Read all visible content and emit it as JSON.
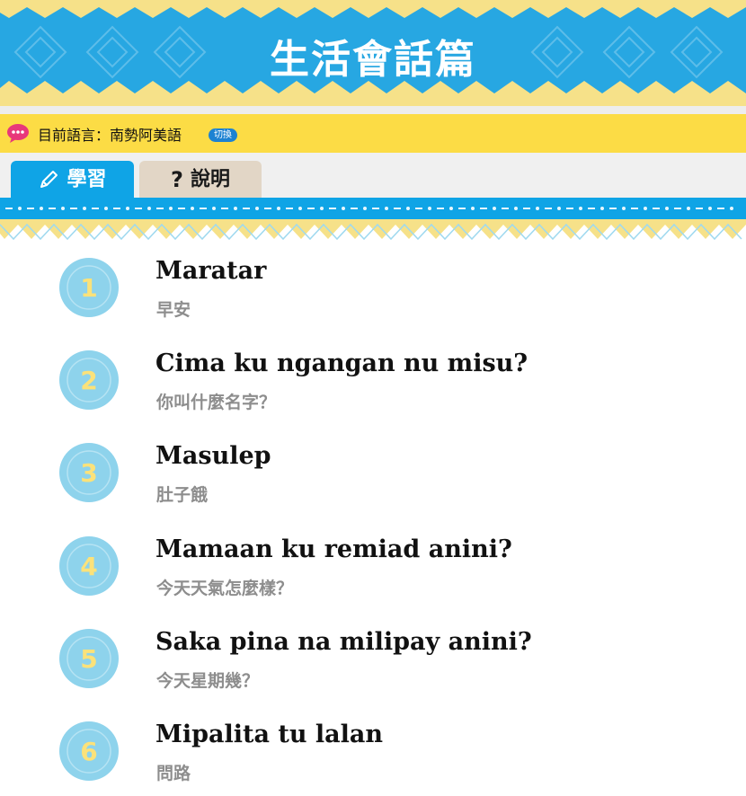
{
  "header": {
    "title": "生活會話篇"
  },
  "language_bar": {
    "icon": "speech-bubble-icon",
    "label": "目前語言：南勢阿美語",
    "switch_label": "切換"
  },
  "tabs": [
    {
      "icon": "pencil-icon",
      "label": "學習",
      "active": true
    },
    {
      "icon": "question-mark-icon",
      "label": "說明",
      "active": false
    }
  ],
  "lessons": [
    {
      "number": "1",
      "phrase": "Maratar",
      "translation": "早安"
    },
    {
      "number": "2",
      "phrase": "Cima ku ngangan nu misu?",
      "translation": "你叫什麼名字？"
    },
    {
      "number": "3",
      "phrase": "Masulep",
      "translation": "肚子餓"
    },
    {
      "number": "4",
      "phrase": "Mamaan ku remiad anini?",
      "translation": "今天天氣怎麼樣？"
    },
    {
      "number": "5",
      "phrase": "Saka pina na milipay anini?",
      "translation": "今天星期幾？"
    },
    {
      "number": "6",
      "phrase": "Mipalita tu lalan",
      "translation": "問路"
    }
  ],
  "colors": {
    "banner_blue": "#27a7e2",
    "yellow": "#fcdc45",
    "tab_active": "#0fa4e6",
    "tab_inactive": "#e2d6c6",
    "badge_fill": "#8ed3ec",
    "badge_number": "#fbe27a"
  }
}
